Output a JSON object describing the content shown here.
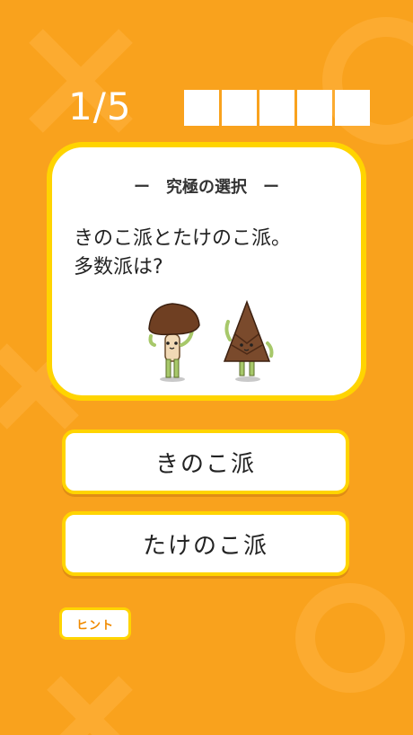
{
  "quiz": {
    "progress": "1/5",
    "slots_total": 5,
    "title": "ー　究極の選択　ー",
    "question_line1": "きのこ派とたけのこ派。",
    "question_line2": "多数派は?"
  },
  "answers": [
    {
      "label": "きのこ派"
    },
    {
      "label": "たけのこ派"
    }
  ],
  "hint": {
    "label": "ヒント"
  },
  "colors": {
    "background": "#f9a21d",
    "card_border": "#ffd400",
    "hint_text": "#f08a00"
  },
  "icons": [
    "mushroom-character-icon",
    "bamboo-shoot-character-icon"
  ]
}
